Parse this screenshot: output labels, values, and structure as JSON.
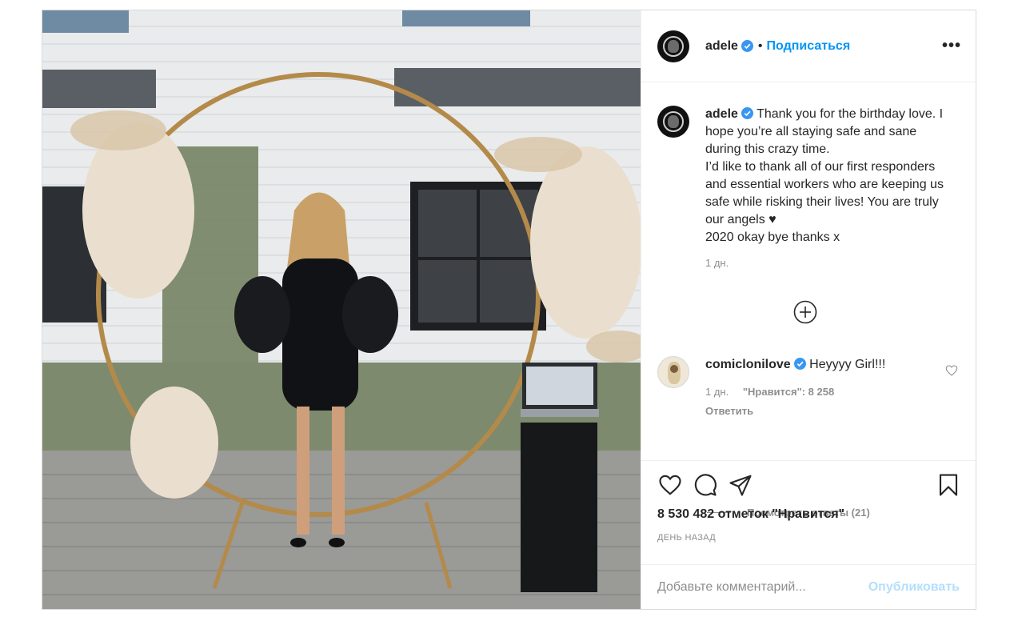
{
  "post": {
    "username": "adele",
    "follow_label": "Подписаться",
    "dot": "•",
    "more_label": "•••"
  },
  "caption": {
    "username": "adele",
    "text": "Thank you for the birthday love. I hope you’re all staying safe and sane during this crazy time.\nI’d like to thank all of our first responders and essential workers who are keeping us safe while risking their lives! You are truly our angels ♥\n2020 okay bye thanks x",
    "time": "1 дн."
  },
  "load_more_icon": "plus-circle-icon",
  "comment": {
    "username": "comiclonilove",
    "text": "Heyyyy Girl!!!",
    "time": "1 дн.",
    "likes": "\"Нравится\": 8 258",
    "reply_label": "Ответить",
    "view_replies": "Посмотреть ответы (21)"
  },
  "actions": {
    "icons": [
      "heart-icon",
      "comment-icon",
      "share-icon",
      "bookmark-icon"
    ],
    "likes_text": "8 530 482 отметок \"Нравится\"",
    "date": "ДЕНЬ НАЗАД"
  },
  "add_comment": {
    "placeholder": "Добавьте комментарий...",
    "publish_label": "Опубликовать"
  },
  "colors": {
    "accent": "#0095f6",
    "publish_disabled": "#b2dffc",
    "muted": "#8e8e8e",
    "border": "#dbdbdb"
  }
}
